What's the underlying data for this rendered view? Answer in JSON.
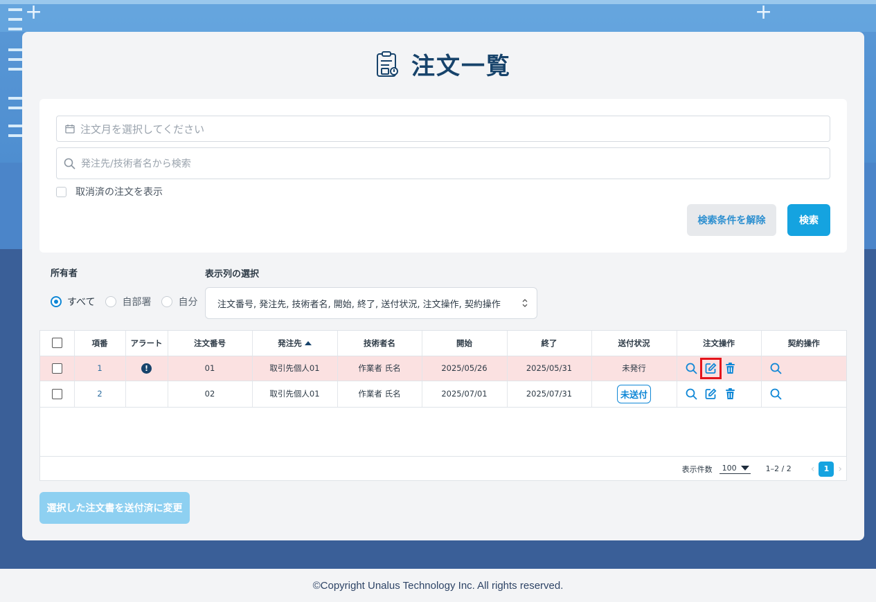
{
  "page": {
    "title": "注文一覧"
  },
  "search": {
    "month_placeholder": "注文月を選択してください",
    "keyword_placeholder": "発注先/技術者名から検索",
    "show_cancelled_label": "取消済の注文を表示",
    "show_cancelled_checked": false,
    "clear_button": "検索条件を解除",
    "search_button": "検索"
  },
  "owner": {
    "label": "所有者",
    "options": [
      "すべて",
      "自部署",
      "自分"
    ],
    "selected": "すべて"
  },
  "columns": {
    "label": "表示列の選択",
    "value": "注文番号, 発注先, 技術者名, 開始, 終了, 送付状況, 注文操作, 契約操作"
  },
  "table": {
    "headers": [
      "",
      "項番",
      "アラート",
      "注文番号",
      "発注先",
      "技術者名",
      "開始",
      "終了",
      "送付状況",
      "注文操作",
      "契約操作"
    ],
    "sorted_column": "発注先",
    "sort_direction": "asc",
    "rows": [
      {
        "no": "1",
        "alert": true,
        "order_no": "01",
        "supplier": "取引先個人01",
        "engineer": "作業者 氏名",
        "start": "2025/05/26",
        "end": "2025/05/31",
        "status": "未発行",
        "status_badge": false,
        "highlight": true
      },
      {
        "no": "2",
        "alert": false,
        "order_no": "02",
        "supplier": "取引先個人01",
        "engineer": "作業者 氏名",
        "start": "2025/07/01",
        "end": "2025/07/31",
        "status": "未送付",
        "status_badge": true,
        "highlight": false
      }
    ]
  },
  "pager": {
    "per_page_label": "表示件数",
    "per_page": "100",
    "range": "1–2 / 2",
    "current_page": "1"
  },
  "bulk_button": "選択した注文書を送付済に変更",
  "footer": "©Copyright Unalus Technology Inc. All rights reserved.",
  "colors": {
    "accent": "#15a3e0",
    "title": "#17436b",
    "row_alert": "#fbe1e1",
    "highlight_border": "#e4141b"
  },
  "icons": [
    "clipboard-order-icon",
    "calendar-icon",
    "search-icon",
    "alert-icon",
    "view-icon",
    "edit-icon",
    "trash-icon",
    "chevron-left-icon",
    "chevron-right-icon",
    "updown-icon"
  ]
}
